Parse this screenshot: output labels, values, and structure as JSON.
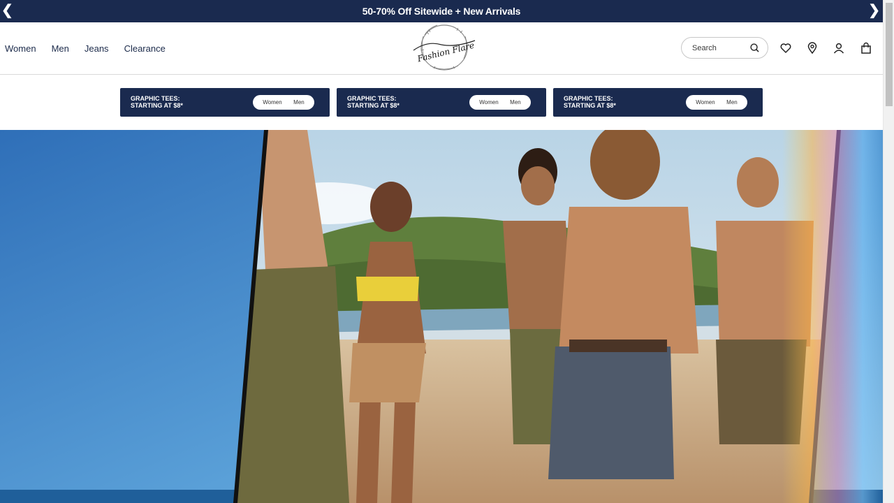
{
  "announcement": {
    "text": "50-70% Off Sitewide + New Arrivals",
    "prev_glyph": "❮",
    "next_glyph": "❯"
  },
  "nav": {
    "items": [
      {
        "label": "Women"
      },
      {
        "label": "Men"
      },
      {
        "label": "Jeans"
      },
      {
        "label": "Clearance"
      }
    ]
  },
  "logo": {
    "brand_text": "Fashion Flare"
  },
  "search": {
    "placeholder": "Search"
  },
  "header_icons": [
    "heart-icon",
    "location-pin-icon",
    "account-icon",
    "shopping-bag-icon"
  ],
  "promos": [
    {
      "line1": "GRAPHIC TEES:",
      "line2": "STARTING AT $8*",
      "option_women": "Women",
      "option_men": "Men"
    },
    {
      "line1": "GRAPHIC TEES:",
      "line2": "STARTING AT $8*",
      "option_women": "Women",
      "option_men": "Men"
    },
    {
      "line1": "GRAPHIC TEES:",
      "line2": "STARTING AT $8*",
      "option_women": "Women",
      "option_men": "Men"
    }
  ],
  "colors": {
    "navy": "#1a2a4f",
    "sky": "#3b86c9",
    "sand": "#c9a57c"
  }
}
